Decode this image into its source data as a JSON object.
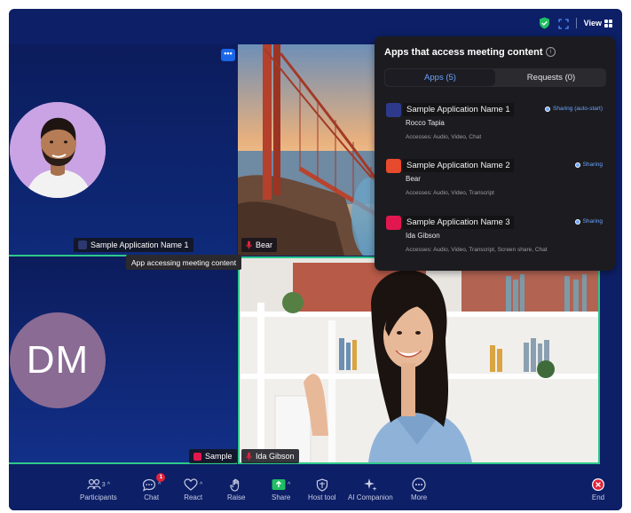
{
  "header": {
    "view_label": "View"
  },
  "tiles": {
    "dm_initials": "DM",
    "app_tag": "Sample Application Name 1",
    "app_tooltip": "App accessing meeting content",
    "bear_name": "Bear",
    "sample_name": "Sample",
    "ida_name": "Ida Gibson",
    "more_label": "•••"
  },
  "panel": {
    "title": "Apps that access meeting content",
    "tabs": [
      {
        "label": "Apps (5)"
      },
      {
        "label": "Requests (0)"
      }
    ],
    "apps": [
      {
        "name": "Sample Application Name 1",
        "user": "Rocco Tapia",
        "accesses": "Accesses: Audio, Video, Chat",
        "status": "Sharing (auto-start)",
        "color": "#2d3a8c"
      },
      {
        "name": "Sample Application Name 2",
        "user": "Bear",
        "accesses": "Accesses: Audio, Video, Transcript",
        "status": "Sharing",
        "color": "#e84a2e"
      },
      {
        "name": "Sample Application Name 3",
        "user": "Ida Gibson",
        "accesses": "Accesses: Audio, Video, Transcript, Screen share, Chat",
        "status": "Sharing",
        "color": "#e3174f"
      }
    ]
  },
  "toolbar": {
    "participants": "Participants",
    "participants_count": "3",
    "chat": "Chat",
    "chat_badge": "1",
    "react": "React",
    "raise": "Raise",
    "share": "Share",
    "host_tool": "Host tool",
    "ai_companion": "AI Companion",
    "more": "More",
    "end": "End"
  },
  "colors": {
    "background": "#0d1f66",
    "accent": "#6aa3ff",
    "active_speaker": "#2ec98a",
    "share_green": "#1fbf62",
    "end_red": "#e2233b"
  }
}
